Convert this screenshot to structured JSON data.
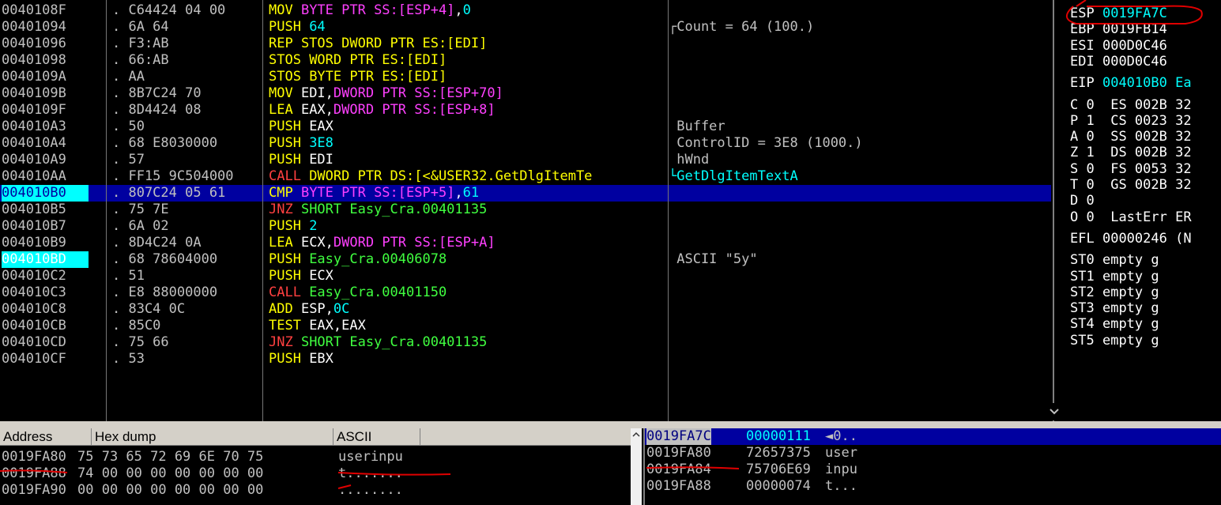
{
  "colors": {
    "bg": "#000000",
    "addr": "#c0c0c0",
    "hex": "#c0c0c0",
    "mnem": "#ffff00",
    "reg": "#ffffff",
    "num": "#00ffff",
    "mem": "#ff40ff",
    "call": "#ff4040",
    "jump": "#40ff40",
    "comment": "#c0c0c0",
    "selected_bg": "#0000a0",
    "eip_addr_bg": "#00ffff",
    "annotation": "#e00000"
  },
  "disasm": {
    "rows": [
      {
        "addr": "0040108F",
        "hex": ". C64424 04 00",
        "op": [
          {
            "t": "MOV ",
            "c": "mnem"
          },
          {
            "t": "BYTE PTR SS:[ESP+4]",
            "c": "mem"
          },
          {
            "t": ",",
            "c": "reg"
          },
          {
            "t": "0",
            "c": "num"
          }
        ],
        "comment": ""
      },
      {
        "addr": "00401094",
        "hex": ". 6A 64",
        "op": [
          {
            "t": "PUSH ",
            "c": "mnem"
          },
          {
            "t": "64",
            "c": "num"
          }
        ],
        "comment": "┌Count = 64 (100.)"
      },
      {
        "addr": "00401096",
        "hex": ". F3:AB",
        "op": [
          {
            "t": "REP STOS ",
            "c": "mnem"
          },
          {
            "t": "DWORD PTR ES:[EDI]",
            "c": "mnem"
          }
        ],
        "comment": ""
      },
      {
        "addr": "00401098",
        "hex": ". 66:AB",
        "op": [
          {
            "t": "STOS ",
            "c": "mnem"
          },
          {
            "t": "WORD PTR ES:[EDI]",
            "c": "mnem"
          }
        ],
        "comment": ""
      },
      {
        "addr": "0040109A",
        "hex": ". AA",
        "op": [
          {
            "t": "STOS ",
            "c": "mnem"
          },
          {
            "t": "BYTE PTR ES:[EDI]",
            "c": "mnem"
          }
        ],
        "comment": ""
      },
      {
        "addr": "0040109B",
        "hex": ". 8B7C24 70",
        "op": [
          {
            "t": "MOV ",
            "c": "mnem"
          },
          {
            "t": "EDI",
            "c": "reg"
          },
          {
            "t": ",",
            "c": "reg"
          },
          {
            "t": "DWORD PTR SS:[ESP+70]",
            "c": "mem"
          }
        ],
        "comment": ""
      },
      {
        "addr": "0040109F",
        "hex": ". 8D4424 08",
        "op": [
          {
            "t": "LEA ",
            "c": "mnem"
          },
          {
            "t": "EAX",
            "c": "reg"
          },
          {
            "t": ",",
            "c": "reg"
          },
          {
            "t": "DWORD PTR SS:[ESP+8]",
            "c": "mem"
          }
        ],
        "comment": ""
      },
      {
        "addr": "004010A3",
        "hex": ". 50",
        "op": [
          {
            "t": "PUSH ",
            "c": "mnem"
          },
          {
            "t": "EAX",
            "c": "reg"
          }
        ],
        "comment": " Buffer"
      },
      {
        "addr": "004010A4",
        "hex": ". 68 E8030000",
        "op": [
          {
            "t": "PUSH ",
            "c": "mnem"
          },
          {
            "t": "3E8",
            "c": "num"
          }
        ],
        "comment": " ControlID = 3E8 (1000.)"
      },
      {
        "addr": "004010A9",
        "hex": ". 57",
        "op": [
          {
            "t": "PUSH ",
            "c": "mnem"
          },
          {
            "t": "EDI",
            "c": "reg"
          }
        ],
        "comment": " hWnd"
      },
      {
        "addr": "004010AA",
        "hex": ". FF15 9C504000",
        "op": [
          {
            "t": "CALL ",
            "c": "call"
          },
          {
            "t": "DWORD PTR DS:[<&USER32.GetDlgItemTe",
            "c": "mnem"
          }
        ],
        "comment": "└GetDlgItemTextA",
        "commentColor": "num"
      },
      {
        "addr": "004010B0",
        "hex": ". 807C24 05 61",
        "op": [
          {
            "t": "CMP ",
            "c": "mnem"
          },
          {
            "t": "BYTE PTR SS:[ESP+5]",
            "c": "mem"
          },
          {
            "t": ",",
            "c": "reg"
          },
          {
            "t": "61",
            "c": "num"
          }
        ],
        "comment": "",
        "selected": true
      },
      {
        "addr": "004010B5",
        "hex": ". 75 7E",
        "op": [
          {
            "t": "JNZ ",
            "c": "call"
          },
          {
            "t": "SHORT Easy_Cra.00401135",
            "c": "jump"
          }
        ],
        "comment": ""
      },
      {
        "addr": "004010B7",
        "hex": ". 6A 02",
        "op": [
          {
            "t": "PUSH ",
            "c": "mnem"
          },
          {
            "t": "2",
            "c": "num"
          }
        ],
        "comment": ""
      },
      {
        "addr": "004010B9",
        "hex": ". 8D4C24 0A",
        "op": [
          {
            "t": "LEA ",
            "c": "mnem"
          },
          {
            "t": "ECX",
            "c": "reg"
          },
          {
            "t": ",",
            "c": "reg"
          },
          {
            "t": "DWORD PTR SS:[ESP+A]",
            "c": "mem"
          }
        ],
        "comment": ""
      },
      {
        "addr": "004010BD",
        "hex": ". 68 78604000",
        "op": [
          {
            "t": "PUSH ",
            "c": "mnem"
          },
          {
            "t": "Easy_Cra.00406078",
            "c": "jump"
          }
        ],
        "comment": " ASCII \"5y\"",
        "eipmark": true
      },
      {
        "addr": "004010C2",
        "hex": ". 51",
        "op": [
          {
            "t": "PUSH ",
            "c": "mnem"
          },
          {
            "t": "ECX",
            "c": "reg"
          }
        ],
        "comment": ""
      },
      {
        "addr": "004010C3",
        "hex": ". E8 88000000",
        "op": [
          {
            "t": "CALL ",
            "c": "call"
          },
          {
            "t": "Easy_Cra.00401150",
            "c": "jump"
          }
        ],
        "comment": ""
      },
      {
        "addr": "004010C8",
        "hex": ". 83C4 0C",
        "op": [
          {
            "t": "ADD ",
            "c": "mnem"
          },
          {
            "t": "ESP",
            "c": "reg"
          },
          {
            "t": ",",
            "c": "reg"
          },
          {
            "t": "0C",
            "c": "num"
          }
        ],
        "comment": ""
      },
      {
        "addr": "004010CB",
        "hex": ". 85C0",
        "op": [
          {
            "t": "TEST ",
            "c": "mnem"
          },
          {
            "t": "EAX",
            "c": "reg"
          },
          {
            "t": ",",
            "c": "reg"
          },
          {
            "t": "EAX",
            "c": "reg"
          }
        ],
        "comment": ""
      },
      {
        "addr": "004010CD",
        "hex": ". 75 66",
        "op": [
          {
            "t": "JNZ ",
            "c": "call"
          },
          {
            "t": "SHORT Easy_Cra.00401135",
            "c": "jump"
          }
        ],
        "comment": ""
      },
      {
        "addr": "004010CF",
        "hex": ". 53",
        "op": [
          {
            "t": "PUSH ",
            "c": "mnem"
          },
          {
            "t": "EBX",
            "c": "reg"
          }
        ],
        "comment": ""
      }
    ]
  },
  "registers": {
    "lines": [
      {
        "k": "ESP",
        "v": "0019FA7C",
        "vc": "num",
        "gap": false
      },
      {
        "k": "EBP",
        "v": "0019FB14",
        "vc": "reg",
        "gap": false
      },
      {
        "k": "ESI",
        "v": "000D0C46",
        "vc": "reg",
        "gap": false
      },
      {
        "k": "EDI",
        "v": "000D0C46",
        "vc": "reg",
        "gap": false
      },
      {
        "k": "EIP",
        "v": "004010B0 Ea",
        "vc": "num",
        "gap": true
      },
      {
        "k": "C 0",
        "v": " ES 002B 32",
        "vc": "reg",
        "gap": true
      },
      {
        "k": "P 1",
        "v": " CS 0023 32",
        "vc": "reg",
        "gap": false
      },
      {
        "k": "A 0",
        "v": " SS 002B 32",
        "vc": "reg",
        "gap": false
      },
      {
        "k": "Z 1",
        "v": " DS 002B 32",
        "vc": "reg",
        "gap": false
      },
      {
        "k": "S 0",
        "v": " FS 0053 32",
        "vc": "reg",
        "gap": false
      },
      {
        "k": "T 0",
        "v": " GS 002B 32",
        "vc": "reg",
        "gap": false
      },
      {
        "k": "D 0",
        "v": "",
        "vc": "reg",
        "gap": false
      },
      {
        "k": "O 0",
        "v": " LastErr ER",
        "vc": "reg",
        "gap": false
      },
      {
        "k": "EFL",
        "v": "00000246 (N",
        "vc": "reg",
        "gap": true
      },
      {
        "k": "ST0",
        "v": "empty g",
        "vc": "reg",
        "gap": true
      },
      {
        "k": "ST1",
        "v": "empty g",
        "vc": "reg",
        "gap": false
      },
      {
        "k": "ST2",
        "v": "empty g",
        "vc": "reg",
        "gap": false
      },
      {
        "k": "ST3",
        "v": "empty g",
        "vc": "reg",
        "gap": false
      },
      {
        "k": "ST4",
        "v": "empty g",
        "vc": "reg",
        "gap": false
      },
      {
        "k": "ST5",
        "v": "empty g",
        "vc": "reg",
        "gap": false
      }
    ]
  },
  "dump": {
    "headers": {
      "address": "Address",
      "hex": "Hex dump",
      "ascii": "ASCII"
    },
    "rows": [
      {
        "addr": "0019FA80",
        "hex": "75 73 65 72 69 6E 70 75",
        "ascii": "userinpu"
      },
      {
        "addr": "0019FA88",
        "hex": "74 00 00 00 00 00 00 00",
        "ascii": "t......."
      },
      {
        "addr": "0019FA90",
        "hex": "00 00 00 00 00 00 00 00",
        "ascii": "........"
      }
    ]
  },
  "stack": {
    "rows": [
      {
        "addr": "0019FA7C",
        "val": "00000111",
        "cmt": "◄0..",
        "selected": true
      },
      {
        "addr": "0019FA80",
        "val": "72657375",
        "cmt": "user",
        "selected": false
      },
      {
        "addr": "0019FA84",
        "val": "75706E69",
        "cmt": "inpu",
        "selected": false
      },
      {
        "addr": "0019FA88",
        "val": "00000074",
        "cmt": "t...",
        "selected": false
      }
    ]
  }
}
